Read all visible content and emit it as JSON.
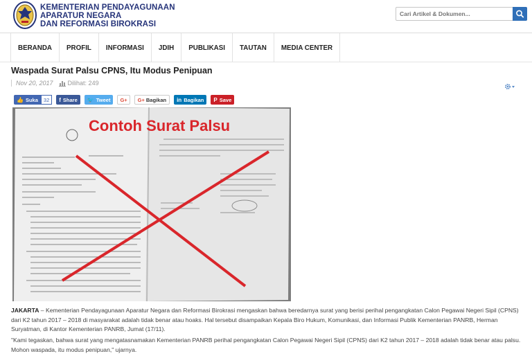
{
  "header": {
    "ministry_line1": "KEMENTERIAN PENDAYAGUNAAN",
    "ministry_line2": "APARATUR NEGARA",
    "ministry_line3": "DAN REFORMASI BIROKRASI",
    "logo_icon": "garuda-emblem-icon"
  },
  "search": {
    "placeholder": "Cari Artikel & Dokumen...",
    "icon": "search-icon"
  },
  "nav": {
    "items": [
      "BERANDA",
      "PROFIL",
      "INFORMASI",
      "JDIH",
      "PUBLIKASI",
      "TAUTAN",
      "MEDIA CENTER"
    ]
  },
  "article": {
    "title": "Waspada Surat Palsu CPNS, Itu Modus Penipuan",
    "date": "Nov 20, 2017",
    "views": "Dilihat: 249",
    "image_caption": "Contoh Surat Palsu",
    "p1_lead": "JAKARTA",
    "p1_rest": " – Kementerian Pendayagunaan Aparatur Negara dan Reformasi Birokrasi mengaskan bahwa beredarnya surat yang berisi perihal pengangkatan Calon Pegawai Negeri Sipil (CPNS) dari K2 tahun 2017 – 2018 di masyarakat adalah tidak benar atau hoaks. Hal tersebut disampaikan Kepala Biro Hukum, Komunikasi, dan Informasi Publik Kementerian PANRB, Herman Suryatman, di Kantor Kementerian PANRB, Jumat (17/11).",
    "p2": "\"Kami tegaskan, bahwa surat yang mengatasnamakan Kementerian PANRB perihal pengangkatan Calon Pegawai Negeri Sipil (CPNS) dari K2 tahun 2017 – 2018 adalah tidak benar atau palsu. Mohon waspada, itu modus penipuan,\" ujarnya."
  },
  "share": {
    "fb_like": "Suka",
    "fb_like_count": "32",
    "fb_share": "Share",
    "tweet": "Tweet",
    "gplus": "G+",
    "gplus_share": "Bagikan",
    "linkedin": "Bagikan",
    "pinterest": "Save"
  },
  "colors": {
    "brand_navy": "#26347a",
    "search_button": "#2f6fb8",
    "stamp_red": "#d9262b"
  }
}
